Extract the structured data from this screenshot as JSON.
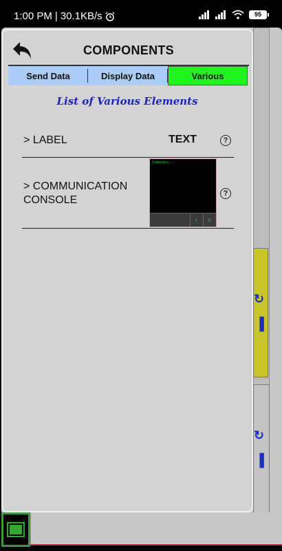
{
  "status_bar": {
    "time": "1:00 PM",
    "separator": "|",
    "network_speed": "30.1KB/s",
    "alarm_icon": "alarm-clock-icon",
    "battery": "95"
  },
  "dialog": {
    "back_icon": "back-arrow-icon",
    "title": "COMPONENTS",
    "tabs": [
      {
        "label": "Send Data",
        "active": false
      },
      {
        "label": "Display Data",
        "active": false
      },
      {
        "label": "Various",
        "active": true
      }
    ],
    "section_title": "List of Various Elements",
    "items": [
      {
        "label": "> LABEL",
        "value": "TEXT",
        "help_icon": "help-circle-icon"
      },
      {
        "label_line1": "> COMMUNICATION",
        "label_line2": "CONSOLE",
        "help_icon": "help-circle-icon",
        "console": {
          "text": "Comandos...",
          "send_label": ">",
          "clear_label": "X"
        }
      }
    ]
  },
  "colors": {
    "tab_inactive": "#a9cdf6",
    "tab_active": "#1df51d",
    "section_title": "#1c24c8",
    "console_text": "#1dd31d",
    "yellow_panel": "#c9c427"
  }
}
